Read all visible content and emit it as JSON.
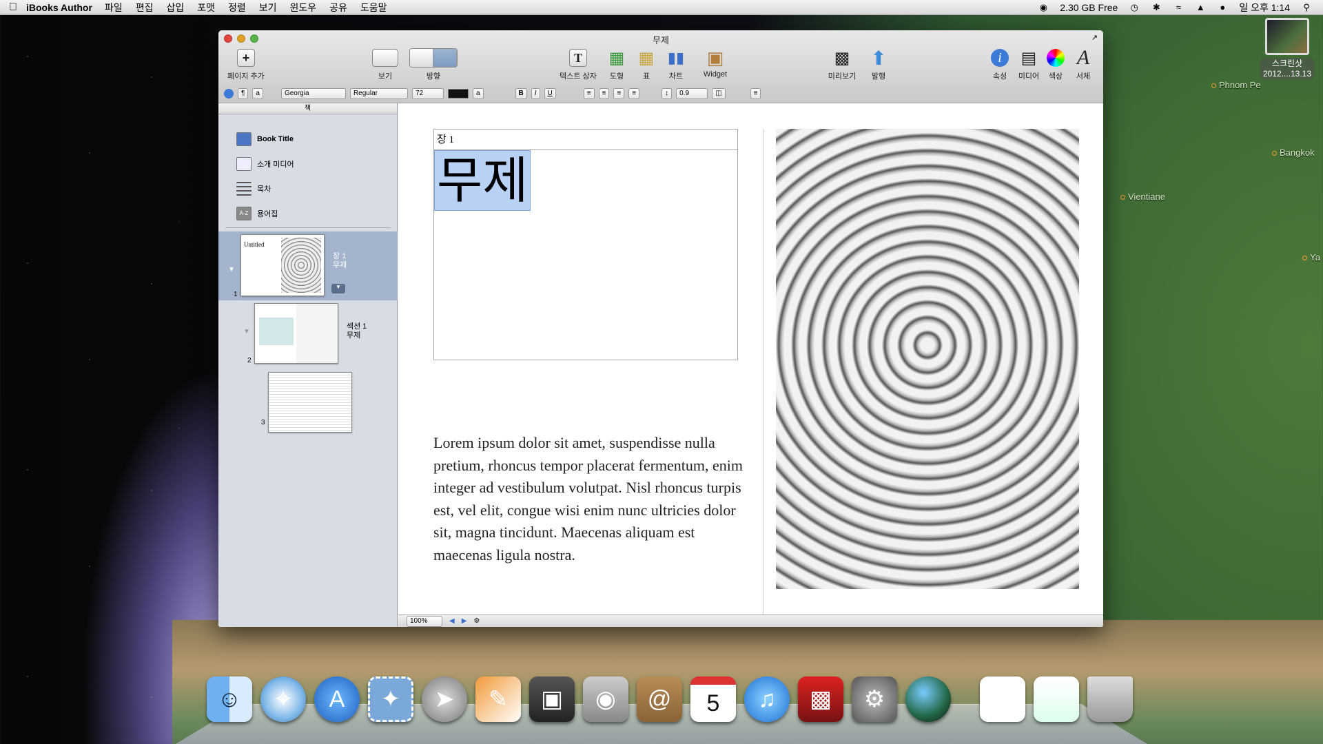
{
  "menubar": {
    "app_name": "iBooks Author",
    "menus": [
      "파일",
      "편집",
      "삽입",
      "포맷",
      "정렬",
      "보기",
      "윈도우",
      "공유",
      "도움말"
    ],
    "disk_free": "2.30 GB Free",
    "clock": "일 오후 1:14"
  },
  "desktop": {
    "icon_label": "스크린샷\n2012....13.13",
    "cities": [
      "Phnom Pe",
      "Bangkok",
      "Vientiane",
      "Ya"
    ]
  },
  "window": {
    "title": "무제",
    "toolbar": {
      "add_page": "페이지 추가",
      "view": "보기",
      "orientation": "방향",
      "text_box": "텍스트 상자",
      "shapes": "도형",
      "table": "표",
      "chart": "차트",
      "widget": "Widget",
      "preview": "미리보기",
      "publish": "발행",
      "inspector": "속성",
      "media": "미디어",
      "colors": "색상",
      "fonts": "서체"
    },
    "format": {
      "paragraph": "¶",
      "char": "a",
      "font": "Georgia",
      "style": "Regular",
      "size": "72",
      "text_color_btn": "a",
      "bold": "B",
      "italic": "I",
      "underline": "U",
      "line_spacing": "0.9"
    },
    "sidebar": {
      "header": "책",
      "items": [
        {
          "label": "Book Title",
          "icon": "book-icon"
        },
        {
          "label": "소개 미디어",
          "icon": "film-icon"
        },
        {
          "label": "목차",
          "icon": "list-icon"
        },
        {
          "label": "용어집",
          "icon": "az-icon"
        }
      ],
      "pages": [
        {
          "num": "1",
          "thumb_title": "Untitled",
          "label": "장 1\n무제"
        },
        {
          "num": "2",
          "label": "섹션 1\n무제"
        },
        {
          "num": "3",
          "label": ""
        }
      ]
    },
    "canvas": {
      "chapter_label": "장 1",
      "heading": "무제",
      "body_text": "Lorem ipsum dolor sit amet, suspendisse nulla pretium, rhoncus tempor placerat fermentum, enim integer ad vestibulum volutpat. Nisl rhoncus turpis est, vel elit, congue wisi enim nunc ultricies dolor sit, magna tincidunt. Maecenas aliquam est maecenas ligula nostra."
    },
    "status": {
      "zoom": "100%"
    }
  },
  "dock": {
    "calendar_day": "5",
    "apps": [
      "finder-icon",
      "safari-icon",
      "app-store-icon",
      "mail-stamp-icon",
      "launchpad-icon",
      "ibooks-author-icon",
      "image-capture-icon",
      "facetime-icon",
      "address-book-icon",
      "calendar-icon",
      "itunes-icon",
      "photo-booth-icon",
      "system-preferences-icon",
      "earth-icon",
      "document-icon",
      "screenshot-icon",
      "trash-icon"
    ]
  }
}
